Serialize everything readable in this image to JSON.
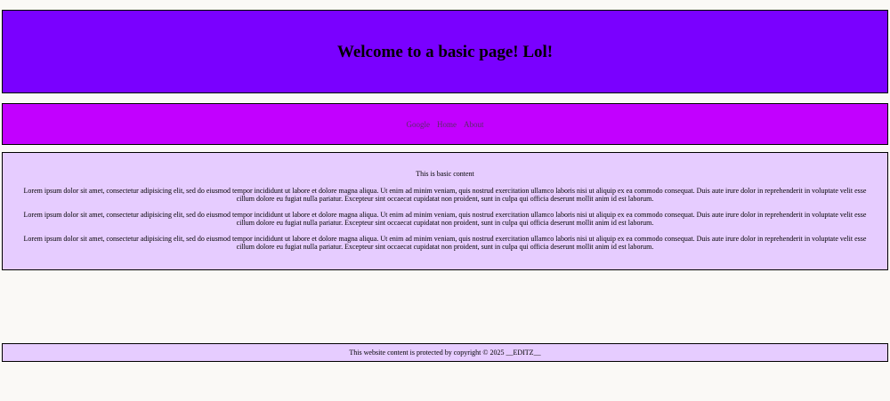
{
  "header": {
    "title": "Welcome to a basic page! Lol!"
  },
  "nav": {
    "links": [
      {
        "label": "Google"
      },
      {
        "label": "Home"
      },
      {
        "label": "About"
      }
    ]
  },
  "content": {
    "title": "This is basic content",
    "paragraphs": [
      "Lorem ipsum dolor sit amet, consectetur adipisicing elit, sed do eiusmod tempor incididunt ut labore et dolore magna aliqua. Ut enim ad minim veniam, quis nostrud exercitation ullamco laboris nisi ut aliquip ex ea commodo consequat. Duis aute irure dolor in reprehenderit in voluptate velit esse cillum dolore eu fugiat nulla pariatur. Excepteur sint occaecat cupidatat non proident, sunt in culpa qui officia deserunt mollit anim id est laborum.",
      "Lorem ipsum dolor sit amet, consectetur adipisicing elit, sed do eiusmod tempor incididunt ut labore et dolore magna aliqua. Ut enim ad minim veniam, quis nostrud exercitation ullamco laboris nisi ut aliquip ex ea commodo consequat. Duis aute irure dolor in reprehenderit in voluptate velit esse cillum dolore eu fugiat nulla pariatur. Excepteur sint occaecat cupidatat non proident, sunt in culpa qui officia deserunt mollit anim id est laborum.",
      "Lorem ipsum dolor sit amet, consectetur adipisicing elit, sed do eiusmod tempor incididunt ut labore et dolore magna aliqua. Ut enim ad minim veniam, quis nostrud exercitation ullamco laboris nisi ut aliquip ex ea commodo consequat. Duis aute irure dolor in reprehenderit in voluptate velit esse cillum dolore eu fugiat nulla pariatur. Excepteur sint occaecat cupidatat non proident, sunt in culpa qui officia deserunt mollit anim id est laborum."
    ]
  },
  "footer": {
    "text": "This website content is protected by copyright © 2025 __EDITZ__"
  },
  "colors": {
    "page_background": "#faf9f6",
    "header_background": "#7a00ff",
    "nav_background": "#c200ff",
    "content_background": "#e6ccff",
    "footer_background": "#e6ccff"
  }
}
